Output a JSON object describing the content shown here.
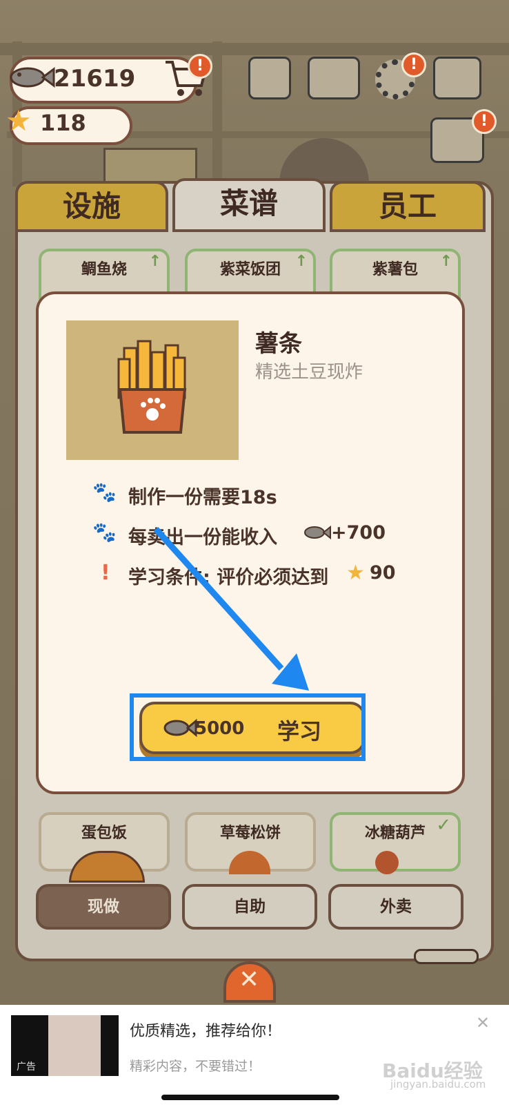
{
  "hud": {
    "fish_amount": "21619",
    "star_amount": "118",
    "alert_mark": "!"
  },
  "tabs": [
    {
      "label": "设施",
      "active": false
    },
    {
      "label": "菜谱",
      "active": true
    },
    {
      "label": "员工",
      "active": false
    }
  ],
  "recipe_cards_top": [
    "鲷鱼烧",
    "紫菜饭团",
    "紫薯包"
  ],
  "recipe_cards_bottom": [
    "蛋包饭",
    "草莓松饼",
    "冰糖葫芦"
  ],
  "bottom_tabs": [
    {
      "label": "现做",
      "active": true
    },
    {
      "label": "自助",
      "active": false
    },
    {
      "label": "外卖",
      "active": false
    }
  ],
  "modal": {
    "item_name": "薯条",
    "item_desc": "精选土豆现炸",
    "info": [
      {
        "icon": "paw-icon",
        "text": "制作一份需要18s"
      },
      {
        "icon": "paw-icon",
        "text": "每卖出一份能收入",
        "value": "+700"
      },
      {
        "icon": "exclamation-icon",
        "text": "学习条件: 评价必须达到",
        "value": "90"
      }
    ],
    "learn_button": {
      "cost": "5000",
      "label": "学习"
    }
  },
  "ad": {
    "title": "优质精选，推荐给你！",
    "subtitle": "精彩内容，不要错过！",
    "thumb_label": "广告",
    "close": "✕",
    "watermark": "Baidu经验",
    "watermark_url": "jingyan.baidu.com"
  },
  "colors": {
    "highlight": "#1e88f0",
    "learn_button": "#f9cb44",
    "tab_inactive": "#c9a43a"
  }
}
